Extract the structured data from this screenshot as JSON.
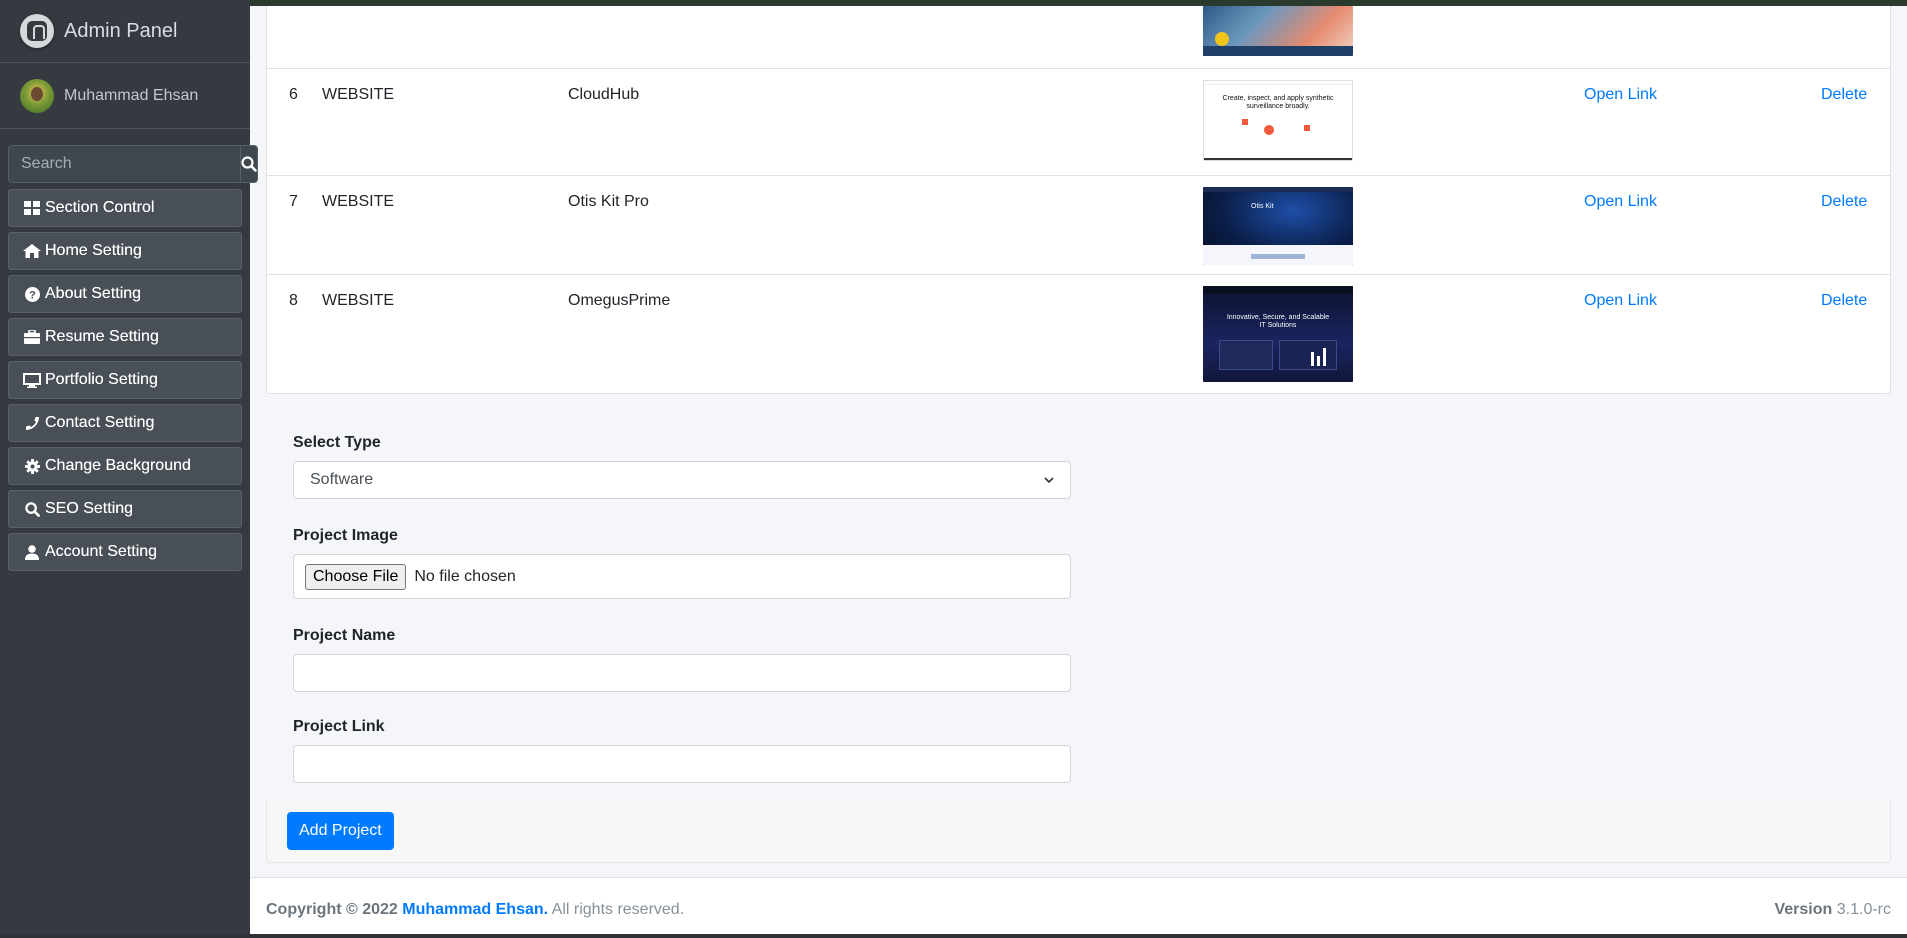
{
  "sidebar": {
    "brand": "Admin Panel",
    "user_name": "Muhammad Ehsan",
    "search_placeholder": "Search",
    "items": [
      {
        "label": "Section Control",
        "icon": "grid-icon"
      },
      {
        "label": "Home Setting",
        "icon": "home-icon"
      },
      {
        "label": "About Setting",
        "icon": "question-circle-icon"
      },
      {
        "label": "Resume Setting",
        "icon": "briefcase-icon"
      },
      {
        "label": "Portfolio Setting",
        "icon": "desktop-icon"
      },
      {
        "label": "Contact Setting",
        "icon": "phone-icon"
      },
      {
        "label": "Change Background",
        "icon": "gear-icon"
      },
      {
        "label": "SEO Setting",
        "icon": "search-icon"
      },
      {
        "label": "Account Setting",
        "icon": "user-icon"
      }
    ]
  },
  "table": {
    "rows": [
      {
        "no": "6",
        "type": "WEBSITE",
        "name": "CloudHub",
        "link": "Open Link",
        "delete": "Delete",
        "thumb_text": "Create, inspect, and apply synthetic surveillance broadly."
      },
      {
        "no": "7",
        "type": "WEBSITE",
        "name": "Otis Kit Pro",
        "link": "Open Link",
        "delete": "Delete",
        "thumb_text": "Otis Kit"
      },
      {
        "no": "8",
        "type": "WEBSITE",
        "name": "OmegusPrime",
        "link": "Open Link",
        "delete": "Delete",
        "thumb_text": "Innovative, Secure, and Scalable IT Solutions"
      }
    ]
  },
  "form": {
    "select_type_label": "Select Type",
    "select_type_value": "Software",
    "image_label": "Project Image",
    "choose_file": "Choose File",
    "no_file": "No file chosen",
    "name_label": "Project Name",
    "link_label": "Project Link",
    "submit": "Add Project"
  },
  "footer": {
    "copyright": "Copyright © 2022",
    "owner": "Muhammad Ehsan.",
    "rights": "All rights reserved.",
    "version_label": "Version",
    "version": "3.1.0-rc"
  },
  "colors": {
    "sidebar": "#343a40",
    "primary": "#007bff"
  }
}
